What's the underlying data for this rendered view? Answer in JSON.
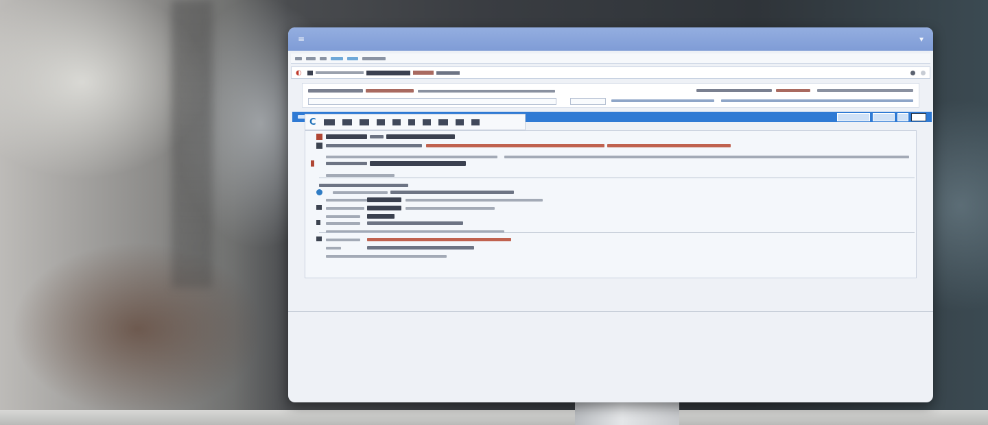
{
  "window": {
    "menu_icon": "hamburger-menu-icon",
    "dropdown_icon": "chevron-down-icon"
  },
  "address_bar": {
    "icon": "browser-icon"
  },
  "toolbar": {
    "icon": "logo-icon"
  },
  "colors": {
    "title_bar": "#7f9cd6",
    "accent_bar": "#2f7ad4",
    "panel_background": "#f4f7fb",
    "highlight_text": "#c0624f"
  }
}
